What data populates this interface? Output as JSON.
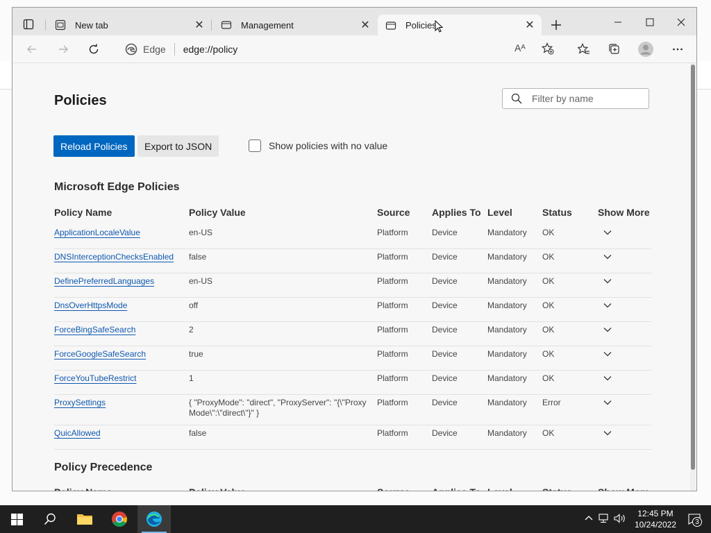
{
  "browser": {
    "tabs": [
      {
        "label": "New tab",
        "active": false
      },
      {
        "label": "Management",
        "active": false
      },
      {
        "label": "Policies",
        "active": true
      }
    ],
    "address": {
      "brand": "Edge",
      "url": "edge://policy"
    },
    "read_aloud_label": "Aᴬ"
  },
  "page": {
    "title": "Policies",
    "filter_placeholder": "Filter by name",
    "reload_button": "Reload Policies",
    "export_button": "Export to JSON",
    "show_no_value_label": "Show policies with no value",
    "section_edge": "Microsoft Edge Policies",
    "section_precedence": "Policy Precedence",
    "columns": [
      "Policy Name",
      "Policy Value",
      "Source",
      "Applies To",
      "Level",
      "Status",
      "Show More"
    ],
    "policies": [
      {
        "name": "ApplicationLocaleValue",
        "value": "en-US",
        "source": "Platform",
        "applies": "Device",
        "level": "Mandatory",
        "status": "OK"
      },
      {
        "name": "DNSInterceptionChecksEnabled",
        "value": "false",
        "source": "Platform",
        "applies": "Device",
        "level": "Mandatory",
        "status": "OK"
      },
      {
        "name": "DefinePreferredLanguages",
        "value": "en-US",
        "source": "Platform",
        "applies": "Device",
        "level": "Mandatory",
        "status": "OK"
      },
      {
        "name": "DnsOverHttpsMode",
        "value": "off",
        "source": "Platform",
        "applies": "Device",
        "level": "Mandatory",
        "status": "OK"
      },
      {
        "name": "ForceBingSafeSearch",
        "value": "2",
        "source": "Platform",
        "applies": "Device",
        "level": "Mandatory",
        "status": "OK"
      },
      {
        "name": "ForceGoogleSafeSearch",
        "value": "true",
        "source": "Platform",
        "applies": "Device",
        "level": "Mandatory",
        "status": "OK"
      },
      {
        "name": "ForceYouTubeRestrict",
        "value": "1",
        "source": "Platform",
        "applies": "Device",
        "level": "Mandatory",
        "status": "OK"
      },
      {
        "name": "ProxySettings",
        "value": "{ \"ProxyMode\": \"direct\", \"ProxyServer\": \"{\\\"ProxyMode\\\":\\\"direct\\\"}\" }",
        "source": "Platform",
        "applies": "Device",
        "level": "Mandatory",
        "status": "Error"
      },
      {
        "name": "QuicAllowed",
        "value": "false",
        "source": "Platform",
        "applies": "Device",
        "level": "Mandatory",
        "status": "OK"
      }
    ]
  },
  "taskbar": {
    "time": "12:45 PM",
    "date": "10/24/2022",
    "notifications": "3"
  },
  "colors": {
    "accent": "#0067c0",
    "link": "#0f58b0"
  }
}
